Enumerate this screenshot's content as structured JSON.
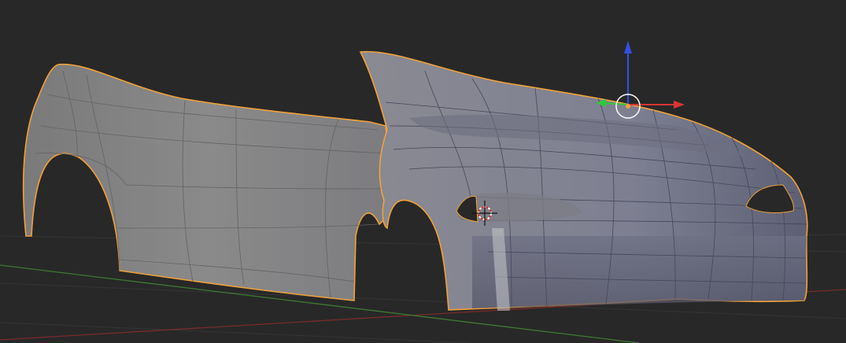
{
  "viewport": {
    "background": "#282828",
    "object": "car body shell",
    "selection_outline_color": "#f2a13a",
    "axis_colors": {
      "x": "#d93434",
      "y": "#2fc93a",
      "z": "#3451e0"
    }
  },
  "gizmo": {
    "type": "translate",
    "icons": [
      "x-axis-arrow-icon",
      "y-axis-arrow-icon",
      "z-axis-arrow-icon",
      "object-origin-icon"
    ]
  },
  "cursor": {
    "icon": "3d-cursor-icon"
  }
}
